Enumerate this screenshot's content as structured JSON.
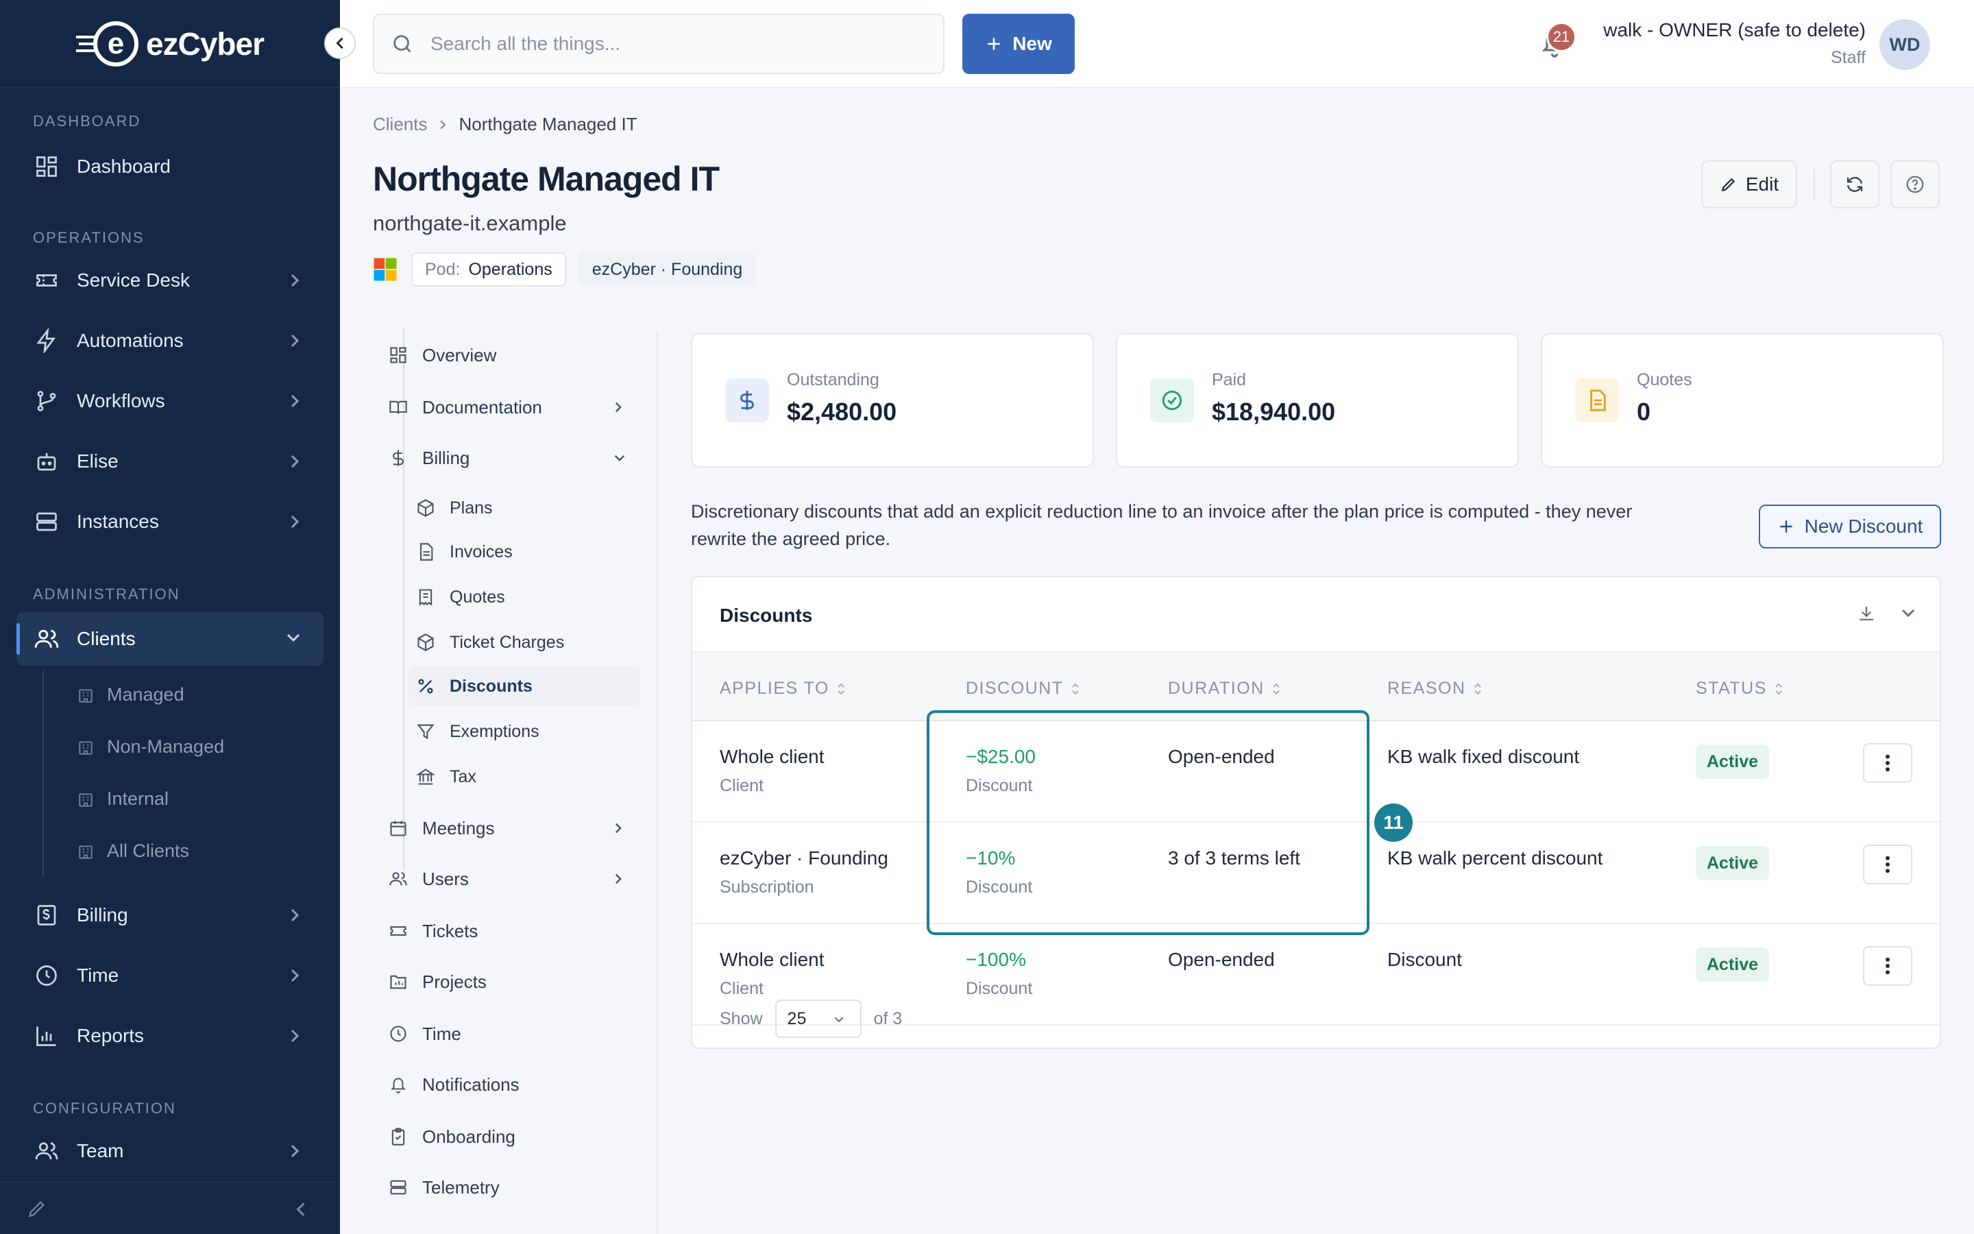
{
  "brand": {
    "name": "ezCyber"
  },
  "sidebar": {
    "sections": {
      "dashboard": "DASHBOARD",
      "operations": "OPERATIONS",
      "administration": "ADMINISTRATION",
      "configuration": "CONFIGURATION"
    },
    "items": {
      "dashboard": "Dashboard",
      "service_desk": "Service Desk",
      "automations": "Automations",
      "workflows": "Workflows",
      "elise": "Elise",
      "instances": "Instances",
      "clients": "Clients",
      "billing": "Billing",
      "time": "Time",
      "reports": "Reports",
      "team": "Team"
    },
    "client_sub": [
      "Managed",
      "Non-Managed",
      "Internal",
      "All Clients"
    ]
  },
  "topbar": {
    "search_placeholder": "Search all the things...",
    "new_label": "New",
    "notification_count": "21",
    "user_name": "walk - OWNER (safe to delete)",
    "user_role": "Staff",
    "avatar_initials": "WD"
  },
  "breadcrumb": {
    "parent": "Clients",
    "current": "Northgate Managed IT"
  },
  "client": {
    "name": "Northgate Managed IT",
    "domain": "northgate-it.example",
    "pod_label": "Pod:",
    "pod_value": "Operations",
    "plan_tag": "ezCyber · Founding"
  },
  "header_actions": {
    "edit": "Edit"
  },
  "subnav": {
    "overview": "Overview",
    "documentation": "Documentation",
    "billing": "Billing",
    "billing_children": [
      "Plans",
      "Invoices",
      "Quotes",
      "Ticket Charges",
      "Discounts",
      "Exemptions",
      "Tax"
    ],
    "meetings": "Meetings",
    "users": "Users",
    "tickets": "Tickets",
    "projects": "Projects",
    "time": "Time",
    "notifications": "Notifications",
    "onboarding": "Onboarding",
    "telemetry": "Telemetry"
  },
  "stats": [
    {
      "label": "Outstanding",
      "value": "$2,480.00",
      "icon": "dollar-icon",
      "color": "#3866b8"
    },
    {
      "label": "Paid",
      "value": "$18,940.00",
      "icon": "check-circle-icon",
      "color": "#1f9b74"
    },
    {
      "label": "Quotes",
      "value": "0",
      "icon": "document-icon",
      "color": "#e0a421"
    }
  ],
  "description": "Discretionary discounts that add an explicit reduction line to an invoice after the plan price is computed - they never rewrite the agreed price.",
  "new_discount_label": "New Discount",
  "discounts": {
    "title": "Discounts",
    "columns": [
      "APPLIES TO",
      "DISCOUNT",
      "DURATION",
      "REASON",
      "STATUS"
    ],
    "rows": [
      {
        "applies_to": "Whole client",
        "applies_type": "Client",
        "discount": "−$25.00",
        "discount_type": "Discount",
        "duration": "Open-ended",
        "reason": "KB walk fixed discount",
        "status": "Active"
      },
      {
        "applies_to": "ezCyber · Founding",
        "applies_type": "Subscription",
        "discount": "−10%",
        "discount_type": "Discount",
        "duration": "3 of 3 terms left",
        "reason": "KB walk percent discount",
        "status": "Active"
      },
      {
        "applies_to": "Whole client",
        "applies_type": "Client",
        "discount": "−100%",
        "discount_type": "Discount",
        "duration": "Open-ended",
        "reason": "Discount",
        "status": "Active"
      }
    ],
    "footer": {
      "show_label": "Show",
      "page_size": "25",
      "of_label": "of 3"
    }
  },
  "annotation": {
    "marker": "11"
  },
  "colors": {
    "sidebar_bg": "#142846",
    "accent": "#3866b8",
    "success": "#1f9b74",
    "highlight": "#1b7f95"
  }
}
